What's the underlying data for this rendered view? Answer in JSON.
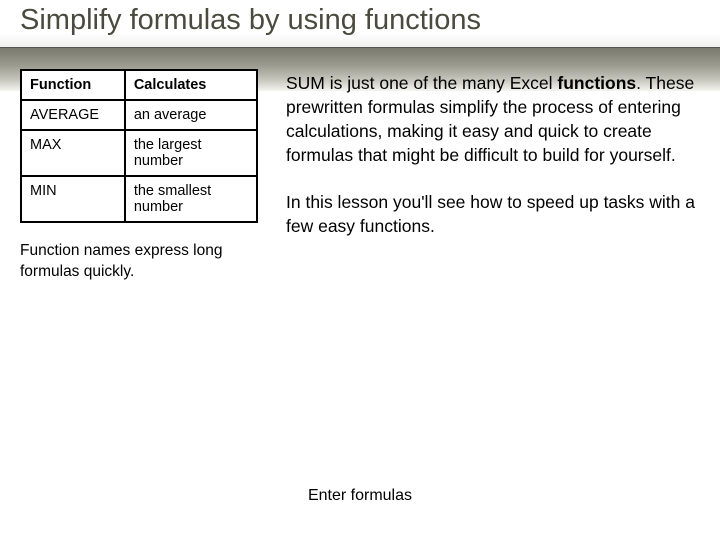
{
  "title": "Simplify formulas by using functions",
  "table": {
    "header": {
      "col1": "Function",
      "col2": "Calculates"
    },
    "rows": [
      {
        "name": "AVERAGE",
        "desc": "an average"
      },
      {
        "name": "MAX",
        "desc": "the largest number"
      },
      {
        "name": "MIN",
        "desc": "the smallest number"
      }
    ]
  },
  "caption": "Function names express long formulas quickly.",
  "body": {
    "p1_a": "SUM is just one of the many Excel ",
    "p1_bold": "functions",
    "p1_b": ". These prewritten formulas simplify the process of entering calculations, making it easy and quick to create formulas that might be difficult to build for yourself.",
    "p2": "In this lesson you'll see how to speed up tasks with a few easy functions."
  },
  "footer": "Enter formulas"
}
